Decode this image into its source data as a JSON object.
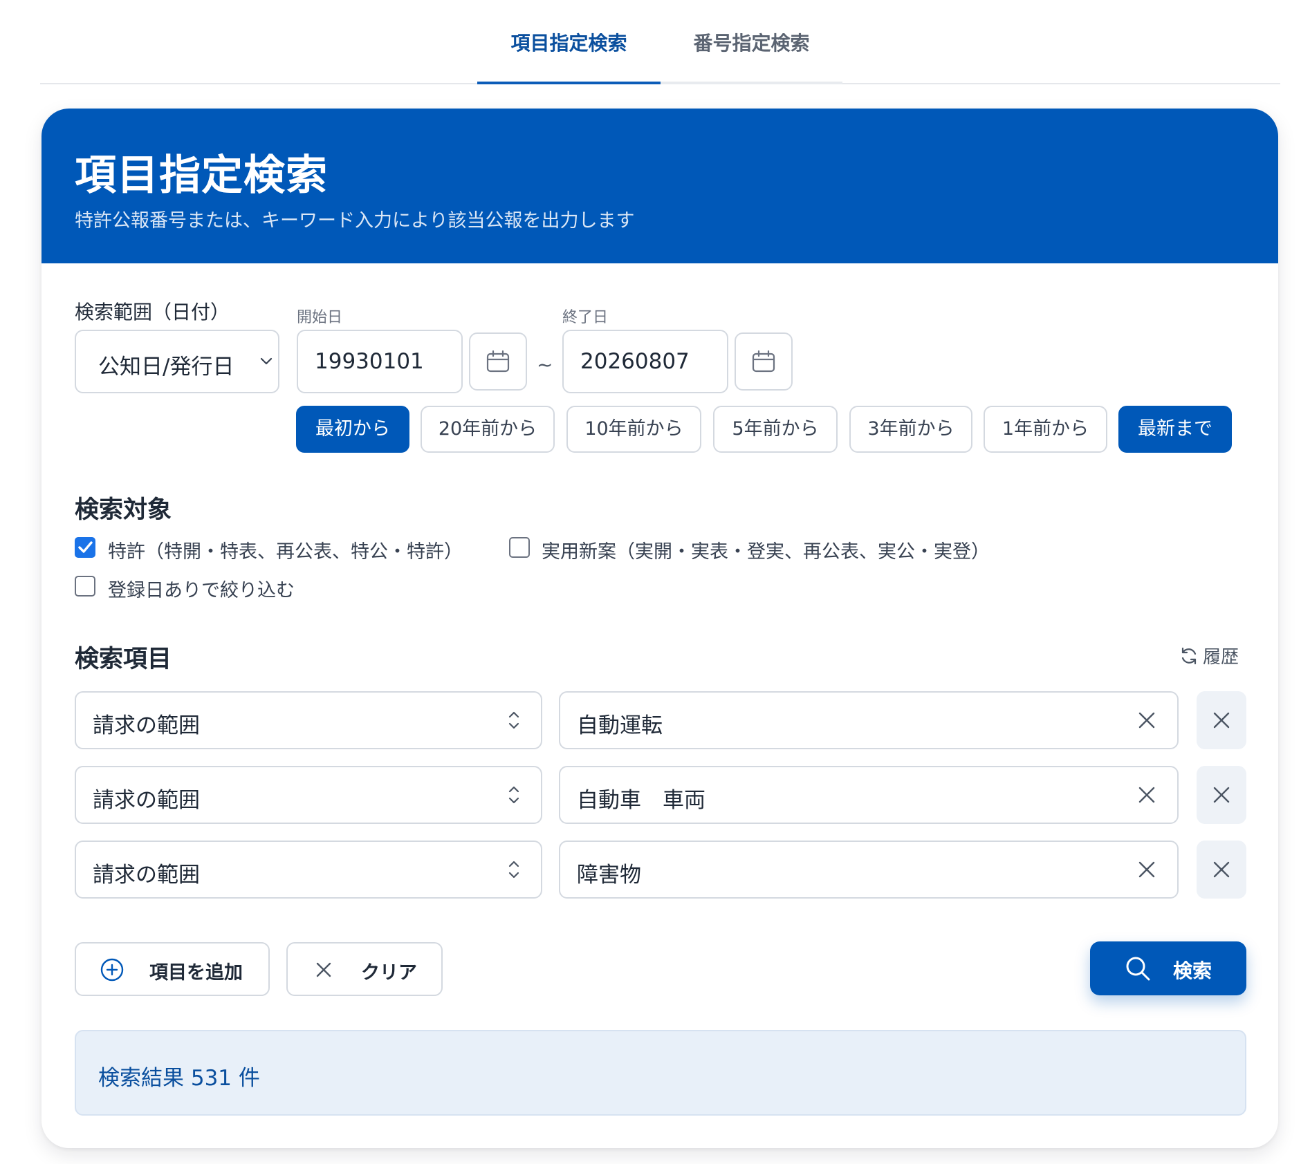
{
  "tabs": [
    {
      "label": "項目指定検索",
      "active": true
    },
    {
      "label": "番号指定検索",
      "active": false
    }
  ],
  "header": {
    "title": "項目指定検索",
    "subtitle": "特許公報番号または、キーワード入力により該当公報を出力します"
  },
  "date_range": {
    "label": "検索範囲（日付）",
    "type_select": "公知日/発行日",
    "start_label": "開始日",
    "start_value": "19930101",
    "end_label": "終了日",
    "end_value": "20260807",
    "separator": "~"
  },
  "range_buttons": [
    {
      "label": "最初から",
      "primary": true
    },
    {
      "label": "20年前から",
      "primary": false
    },
    {
      "label": "10年前から",
      "primary": false
    },
    {
      "label": "5年前から",
      "primary": false
    },
    {
      "label": "3年前から",
      "primary": false
    },
    {
      "label": "1年前から",
      "primary": false
    },
    {
      "label": "最新まで",
      "primary": true
    }
  ],
  "targets": {
    "title": "検索対象",
    "options": [
      {
        "label": "特許（特開・特表、再公表、特公・特許）",
        "checked": true
      },
      {
        "label": "実用新案（実開・実表・登実、再公表、実公・実登）",
        "checked": false
      },
      {
        "label": "登録日ありで絞り込む",
        "checked": false
      }
    ]
  },
  "items": {
    "title": "検索項目",
    "history_label": "履歴",
    "rows": [
      {
        "field": "請求の範囲",
        "value": "自動運転"
      },
      {
        "field": "請求の範囲",
        "value": "自動車　車両"
      },
      {
        "field": "請求の範囲",
        "value": "障害物"
      }
    ]
  },
  "actions": {
    "add_label": "項目を追加",
    "clear_label": "クリア",
    "search_label": "検索"
  },
  "result": {
    "text": "検索結果 531 件"
  },
  "colors": {
    "primary": "#0058b8",
    "result_bg": "#e8f0f9",
    "checkbox": "#1a73e8"
  }
}
